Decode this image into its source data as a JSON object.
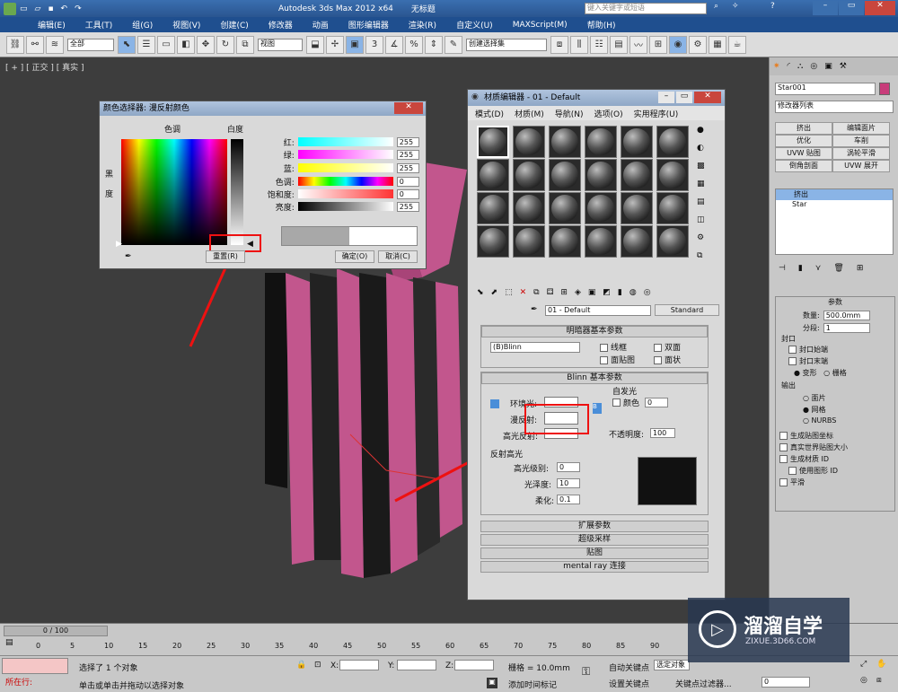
{
  "title": {
    "app": "Autodesk 3ds Max  2012 x64",
    "file": "无标题",
    "search_placeholder": "键入关键字或短语"
  },
  "menu": [
    "编辑(E)",
    "工具(T)",
    "组(G)",
    "视图(V)",
    "创建(C)",
    "修改器",
    "动画",
    "图形编辑器",
    "渲染(R)",
    "自定义(U)",
    "MAXScript(M)",
    "帮助(H)"
  ],
  "toolbar": {
    "filter": "全部",
    "view": "视图",
    "selset": "创建选择集"
  },
  "viewport": {
    "label": "[ + ] [ 正交 ] [ 真实 ]"
  },
  "rpanel": {
    "object_name": "Star001",
    "modifier_list": "修改器列表",
    "buttons": [
      "挤出",
      "编辑面片",
      "优化",
      "车削",
      "UVW 贴图",
      "涡轮平滑",
      "倒角剖面",
      "UVW 展开"
    ],
    "stack": [
      "挤出",
      "Star"
    ],
    "params_title": "参数",
    "amount_label": "数量:",
    "amount": "500.0mm",
    "segs_label": "分段:",
    "segs": "1",
    "cap_title": "封口",
    "cap_start": "封口始端",
    "cap_end": "封口末端",
    "morph": "变形",
    "grid": "栅格",
    "output_title": "输出",
    "out_patch": "面片",
    "out_mesh": "网格",
    "out_nurbs": "NURBS",
    "gen_map": "生成贴图坐标",
    "real_world": "真实世界贴图大小",
    "gen_matid": "生成材质 ID",
    "use_shape_id": "使用图形 ID",
    "smooth": "平滑"
  },
  "colorpicker": {
    "title": "颜色选择器: 漫反射颜色",
    "hue": "色调",
    "white": "白度",
    "black": "黑",
    "degree": "度",
    "rows": [
      {
        "label": "红:",
        "value": "255"
      },
      {
        "label": "绿:",
        "value": "255"
      },
      {
        "label": "蓝:",
        "value": "255"
      },
      {
        "label": "色调:",
        "value": "0"
      },
      {
        "label": "饱和度:",
        "value": "0"
      },
      {
        "label": "亮度:",
        "value": "255"
      }
    ],
    "reset": "重置(R)",
    "ok": "确定(O)",
    "cancel": "取消(C)"
  },
  "mateditor": {
    "title": "材质编辑器 - 01 - Default",
    "menu": [
      "模式(D)",
      "材质(M)",
      "导航(N)",
      "选项(O)",
      "实用程序(U)"
    ],
    "mat_name": "01 - Default",
    "mat_type": "Standard",
    "shader_title": "明暗器基本参数",
    "shader": "(B)Blinn",
    "wire": "线框",
    "twosided": "双面",
    "facemap": "面贴图",
    "faceted": "面状",
    "blinn_title": "Blinn 基本参数",
    "selfillum": "自发光",
    "color": "颜色",
    "selfillum_val": "0",
    "ambient": "环境光:",
    "diffuse": "漫反射:",
    "specular": "高光反射:",
    "opacity": "不透明度:",
    "opacity_val": "100",
    "spec_title": "反射高光",
    "spec_level": "高光级别:",
    "spec_level_val": "0",
    "gloss": "光泽度:",
    "gloss_val": "10",
    "soften": "柔化:",
    "soften_val": "0.1",
    "rollouts": [
      "扩展参数",
      "超级采样",
      "贴图",
      "mental ray 连接"
    ]
  },
  "timeline": {
    "frame": "0 / 100",
    "ticks": [
      "0",
      "5",
      "10",
      "15",
      "20",
      "25",
      "30",
      "35",
      "40",
      "45",
      "50",
      "55",
      "60",
      "65",
      "70",
      "75",
      "80",
      "85",
      "90"
    ]
  },
  "status": {
    "running": "所在行:",
    "selected": "选择了 1 个对象",
    "hint": "单击或单击并拖动以选择对象",
    "x": "X:",
    "y": "Y:",
    "z": "Z:",
    "grid": "栅格 = 10.0mm",
    "addtime": "添加时间标记",
    "autokey": "自动关键点",
    "selobj": "选定对象",
    "setkey": "设置关键点",
    "keyfilter": "关键点过滤器...",
    "frameval": "0"
  },
  "watermark": {
    "brand": "溜溜自学",
    "url": "ZIXUE.3D66.COM"
  }
}
